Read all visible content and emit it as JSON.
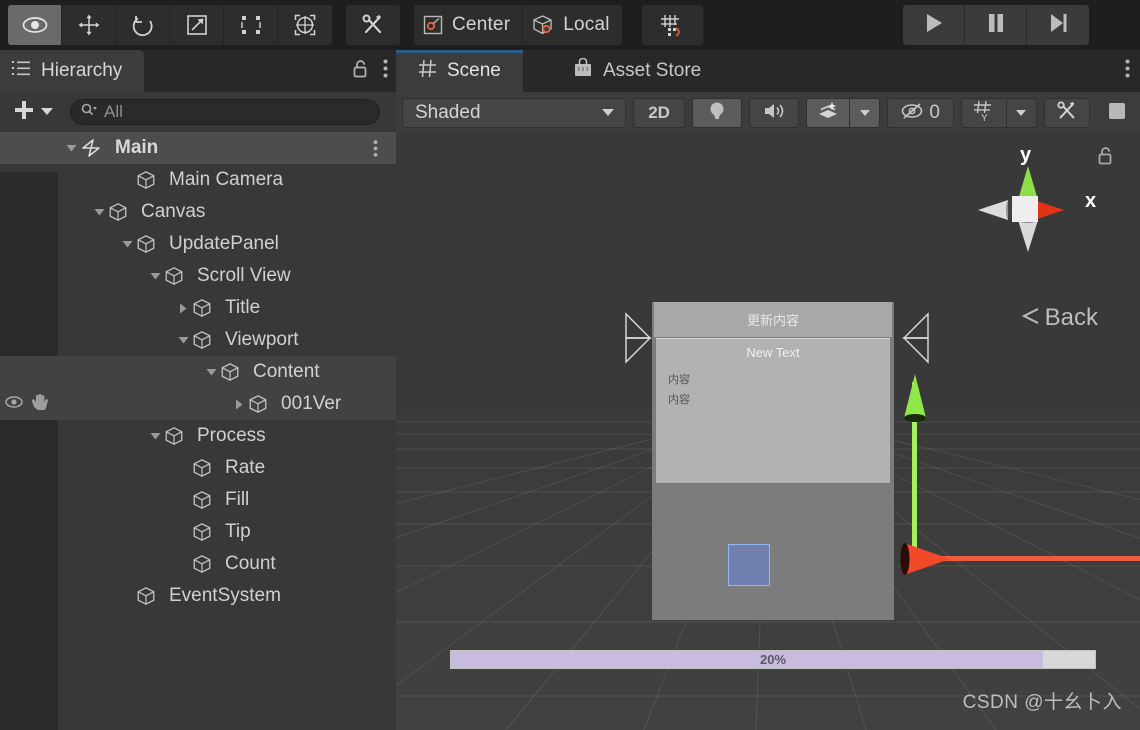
{
  "toolbar": {
    "tools": [
      {
        "name": "hand-tool-icon",
        "label": "",
        "active": true
      },
      {
        "name": "move-tool-icon",
        "label": "",
        "active": false
      },
      {
        "name": "rotate-tool-icon",
        "label": "",
        "active": false
      },
      {
        "name": "scale-tool-icon",
        "label": "",
        "active": false
      },
      {
        "name": "rect-tool-icon",
        "label": "",
        "active": false
      },
      {
        "name": "transform-tool-icon",
        "label": "",
        "active": false
      }
    ],
    "custom_tool_label": "",
    "pivot_mode": "Center",
    "pivot_rotation": "Local",
    "snap_label": "",
    "play_label": "",
    "pause_label": "",
    "step_label": ""
  },
  "hierarchy": {
    "tab_label": "Hierarchy",
    "add_label": "+",
    "search": {
      "value": "",
      "placeholder": "All"
    },
    "rows": [
      {
        "name": "Main",
        "depth": 0,
        "twisty": "down",
        "icon": "unity-scene-icon",
        "selected": true,
        "bold": true,
        "dots": true,
        "eye": false,
        "hand": false
      },
      {
        "name": "Main Camera",
        "depth": 2,
        "twisty": "none",
        "icon": "gameobject-icon",
        "selected": false,
        "bold": false,
        "dots": false,
        "eye": false,
        "hand": false
      },
      {
        "name": "Canvas",
        "depth": 1,
        "twisty": "down",
        "icon": "gameobject-icon",
        "selected": false,
        "bold": false,
        "dots": false,
        "eye": false,
        "hand": false
      },
      {
        "name": "UpdatePanel",
        "depth": 2,
        "twisty": "down",
        "icon": "gameobject-icon",
        "selected": false,
        "bold": false,
        "dots": false,
        "eye": false,
        "hand": false
      },
      {
        "name": "Scroll View",
        "depth": 3,
        "twisty": "down",
        "icon": "gameobject-icon",
        "selected": false,
        "bold": false,
        "dots": false,
        "eye": false,
        "hand": false
      },
      {
        "name": "Title",
        "depth": 4,
        "twisty": "right",
        "icon": "gameobject-icon",
        "selected": false,
        "bold": false,
        "dots": false,
        "eye": false,
        "hand": false
      },
      {
        "name": "Viewport",
        "depth": 4,
        "twisty": "down",
        "icon": "gameobject-icon",
        "selected": false,
        "bold": false,
        "dots": false,
        "eye": false,
        "hand": false
      },
      {
        "name": "Content",
        "depth": 5,
        "twisty": "down",
        "icon": "gameobject-icon",
        "selected": false,
        "bold": false,
        "dots": false,
        "eye": false,
        "hand": false,
        "highlight": true
      },
      {
        "name": "001Ver",
        "depth": 6,
        "twisty": "right",
        "icon": "gameobject-icon",
        "selected": false,
        "bold": false,
        "dots": false,
        "eye": true,
        "hand": true,
        "highlight": true
      },
      {
        "name": "Process",
        "depth": 3,
        "twisty": "down",
        "icon": "gameobject-icon",
        "selected": false,
        "bold": false,
        "dots": false,
        "eye": false,
        "hand": false
      },
      {
        "name": "Rate",
        "depth": 4,
        "twisty": "none",
        "icon": "gameobject-icon",
        "selected": false,
        "bold": false,
        "dots": false,
        "eye": false,
        "hand": false
      },
      {
        "name": "Fill",
        "depth": 4,
        "twisty": "none",
        "icon": "gameobject-icon",
        "selected": false,
        "bold": false,
        "dots": false,
        "eye": false,
        "hand": false
      },
      {
        "name": "Tip",
        "depth": 4,
        "twisty": "none",
        "icon": "gameobject-icon",
        "selected": false,
        "bold": false,
        "dots": false,
        "eye": false,
        "hand": false
      },
      {
        "name": "Count",
        "depth": 4,
        "twisty": "none",
        "icon": "gameobject-icon",
        "selected": false,
        "bold": false,
        "dots": false,
        "eye": false,
        "hand": false
      },
      {
        "name": "EventSystem",
        "depth": 2,
        "twisty": "none",
        "icon": "gameobject-icon",
        "selected": false,
        "bold": false,
        "dots": false,
        "eye": false,
        "hand": false
      }
    ]
  },
  "scene_panel": {
    "tabs": [
      {
        "label": "Scene",
        "icon": "grid-icon",
        "active": true
      },
      {
        "label": "Asset Store",
        "icon": "store-icon",
        "active": false
      }
    ],
    "toolbar": {
      "draw_mode": "Shaded",
      "two_d_label": "2D",
      "lighting_label": "",
      "audio_label": "",
      "effects_label": "",
      "hidden_count": "0",
      "grid_label": "",
      "component_tools_label": "",
      "fullscreen_label": ""
    },
    "gizmo": {
      "x_label": "x",
      "y_label": "y",
      "back_label": "Back",
      "lock_label": ""
    },
    "canvas_preview": {
      "header_text": "更新内容",
      "new_text": "New Text",
      "content_lines": [
        "内容",
        "内容"
      ],
      "progress_value": "20%",
      "progress_percent": 92
    },
    "watermark": "CSDN @十幺卜入"
  },
  "colors": {
    "accent_blue": "#2c5d87",
    "axis_x": "#ee5a3c",
    "axis_y": "#a6f060",
    "selection": "#4d4d4d",
    "panel_bg": "#383838",
    "toolbar_bg": "#1e1e1e",
    "progress_fill": "#c7bcdd"
  }
}
